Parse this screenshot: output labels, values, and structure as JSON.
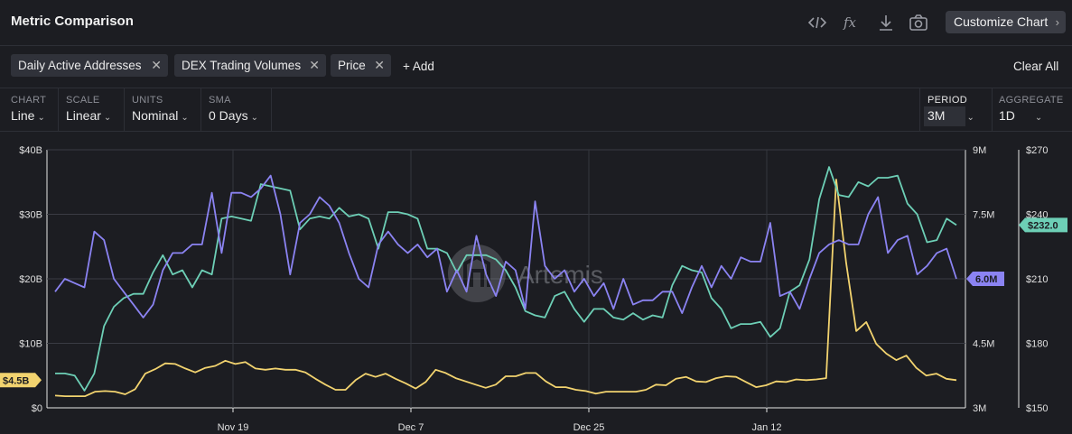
{
  "header": {
    "title": "Metric Comparison",
    "code_icon": "code-icon",
    "fx_icon": "function-icon",
    "download_icon": "download-icon",
    "camera_icon": "camera-icon",
    "customize_label": "Customize Chart"
  },
  "metrics": {
    "chips": [
      {
        "label": "Daily Active Addresses"
      },
      {
        "label": "DEX Trading Volumes"
      },
      {
        "label": "Price"
      }
    ],
    "add_label": "+ Add",
    "clear_label": "Clear All"
  },
  "controls": {
    "chart": {
      "key": "CHART",
      "value": "Line"
    },
    "scale": {
      "key": "SCALE",
      "value": "Linear"
    },
    "units": {
      "key": "UNITS",
      "value": "Nominal"
    },
    "sma": {
      "key": "SMA",
      "value": "0 Days"
    },
    "period": {
      "key": "PERIOD",
      "value": "3M"
    },
    "aggregate": {
      "key": "AGGREGATE",
      "value": "1D"
    }
  },
  "chart_data": {
    "type": "line",
    "watermark": "Artemis",
    "grid": true,
    "colors": {
      "teal": "#6dcfb6",
      "purple": "#8b83f2",
      "yellow": "#f2d36f"
    },
    "x_ticks": [
      "Nov 19",
      "Dec 7",
      "Dec 25",
      "Jan 12"
    ],
    "axes": {
      "left": {
        "ticks": [
          "$0",
          "$10B",
          "$20B",
          "$30B",
          "$40B"
        ],
        "range": [
          0,
          40
        ]
      },
      "mid": {
        "ticks": [
          "3M",
          "4.5M",
          "6M",
          "7.5M",
          "9M"
        ],
        "range": [
          3,
          9
        ]
      },
      "right": {
        "ticks": [
          "$150",
          "$180",
          "$210",
          "$240",
          "$270"
        ],
        "range": [
          150,
          270
        ]
      }
    },
    "end_labels": {
      "left": "$4.5B",
      "mid": "6.0M",
      "right": "$232.0"
    },
    "series": [
      {
        "axis": "left",
        "color": "#f2d36f",
        "values": [
          1.9,
          1.8,
          1.8,
          1.8,
          2.5,
          2.6,
          2.5,
          2.1,
          2.9,
          5.3,
          6.0,
          6.9,
          6.8,
          6.1,
          5.5,
          6.2,
          6.5,
          7.3,
          6.8,
          7.1,
          6.1,
          5.9,
          6.1,
          5.9,
          5.9,
          5.5,
          4.5,
          3.6,
          2.8,
          2.8,
          4.3,
          5.3,
          4.8,
          5.3,
          4.5,
          3.8,
          3.0,
          4.0,
          5.9,
          5.4,
          4.6,
          4.1,
          3.6,
          3.1,
          3.6,
          4.9,
          4.9,
          5.4,
          5.4,
          4.1,
          3.2,
          3.2,
          2.8,
          2.6,
          2.2,
          2.5,
          2.5,
          2.5,
          2.5,
          2.8,
          3.6,
          3.5,
          4.5,
          4.8,
          4.1,
          4.0,
          4.6,
          4.9,
          4.8,
          4.0,
          3.2,
          3.5,
          4.1,
          4.0,
          4.4,
          4.3,
          4.4,
          4.6,
          35.4,
          22.4,
          11.9,
          13.3,
          9.9,
          8.4,
          7.4,
          8.1,
          6.2,
          5.0,
          5.3,
          4.5,
          4.3
        ]
      },
      {
        "axis": "right",
        "color": "#6dcfb6",
        "values": [
          166,
          166,
          165,
          158,
          166,
          188,
          197,
          201,
          203,
          203,
          213,
          221,
          212,
          214,
          206,
          214,
          212,
          238,
          239,
          238,
          237,
          254,
          253,
          252,
          251,
          233,
          238,
          239,
          238,
          243,
          239,
          240,
          238,
          224,
          241,
          241,
          240,
          238,
          224,
          224,
          222,
          213,
          221,
          221,
          221,
          219,
          214,
          206,
          195,
          193,
          192,
          202,
          204,
          196,
          190,
          196,
          196,
          192,
          191,
          194,
          191,
          193,
          192,
          207,
          216,
          214,
          213,
          201,
          196,
          187,
          189,
          189,
          190,
          183,
          187,
          204,
          207,
          219,
          247,
          262,
          249,
          248,
          255,
          253,
          257,
          257,
          258,
          245,
          240,
          227,
          228,
          238,
          235
        ]
      },
      {
        "axis": "mid",
        "color": "#8b83f2",
        "values": [
          5.7,
          6.0,
          5.9,
          5.8,
          7.1,
          6.9,
          6.0,
          5.7,
          5.4,
          5.1,
          5.4,
          6.2,
          6.6,
          6.6,
          6.8,
          6.8,
          8.0,
          6.6,
          8.0,
          8.0,
          7.9,
          8.1,
          8.4,
          7.5,
          6.1,
          7.3,
          7.5,
          7.9,
          7.7,
          7.3,
          6.6,
          6.0,
          5.8,
          6.8,
          7.1,
          6.8,
          6.6,
          6.8,
          6.5,
          6.7,
          5.7,
          6.2,
          5.7,
          7.0,
          6.1,
          5.6,
          6.4,
          6.2,
          5.3,
          7.8,
          6.3,
          6.0,
          6.2,
          5.7,
          6.0,
          5.6,
          5.9,
          5.3,
          6.0,
          5.4,
          5.5,
          5.5,
          5.7,
          5.7,
          5.2,
          5.8,
          6.3,
          5.8,
          6.3,
          6.0,
          6.5,
          6.4,
          6.4,
          7.3,
          5.6,
          5.7,
          5.3,
          6.0,
          6.6,
          6.8,
          6.9,
          6.8,
          6.8,
          7.5,
          7.9,
          6.6,
          6.9,
          7.0,
          6.1,
          6.3,
          6.6,
          6.7,
          6.0
        ]
      }
    ]
  }
}
